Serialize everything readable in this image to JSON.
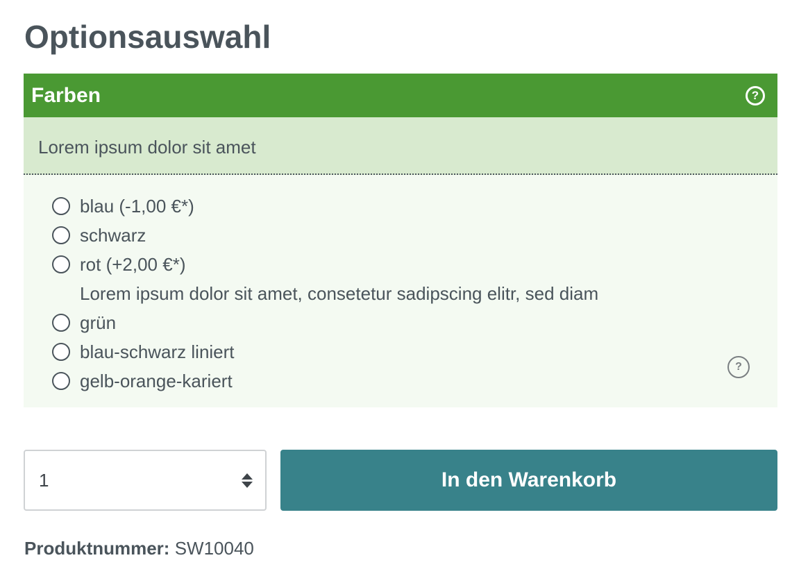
{
  "page": {
    "title": "Optionsauswahl"
  },
  "option_group": {
    "title": "Farben",
    "description": "Lorem ipsum dolor sit amet",
    "options": [
      {
        "label": "blau (-1,00 €*)",
        "selected": false
      },
      {
        "label": "schwarz",
        "selected": false
      },
      {
        "label": "rot (+2,00 €*)",
        "selected": false,
        "note": "Lorem ipsum dolor sit amet, consetetur sadipscing elitr, sed diam"
      },
      {
        "label": "grün",
        "selected": false
      },
      {
        "label": "blau-schwarz liniert",
        "selected": false
      },
      {
        "label": "gelb-orange-kariert",
        "selected": false
      }
    ],
    "header_icon": "help-circle-icon",
    "option_icon": "help-circle-icon",
    "help_glyph": "?"
  },
  "buy_box": {
    "quantity": "1",
    "add_to_cart_label": "In den Warenkorb"
  },
  "product": {
    "number_label": "Produktnummer:",
    "number_value": "SW10040"
  },
  "colors": {
    "header_green": "#4a9933",
    "description_bg": "#d8eacf",
    "options_bg": "#f4faf2",
    "button_teal": "#38828a",
    "text": "#4a545b"
  }
}
